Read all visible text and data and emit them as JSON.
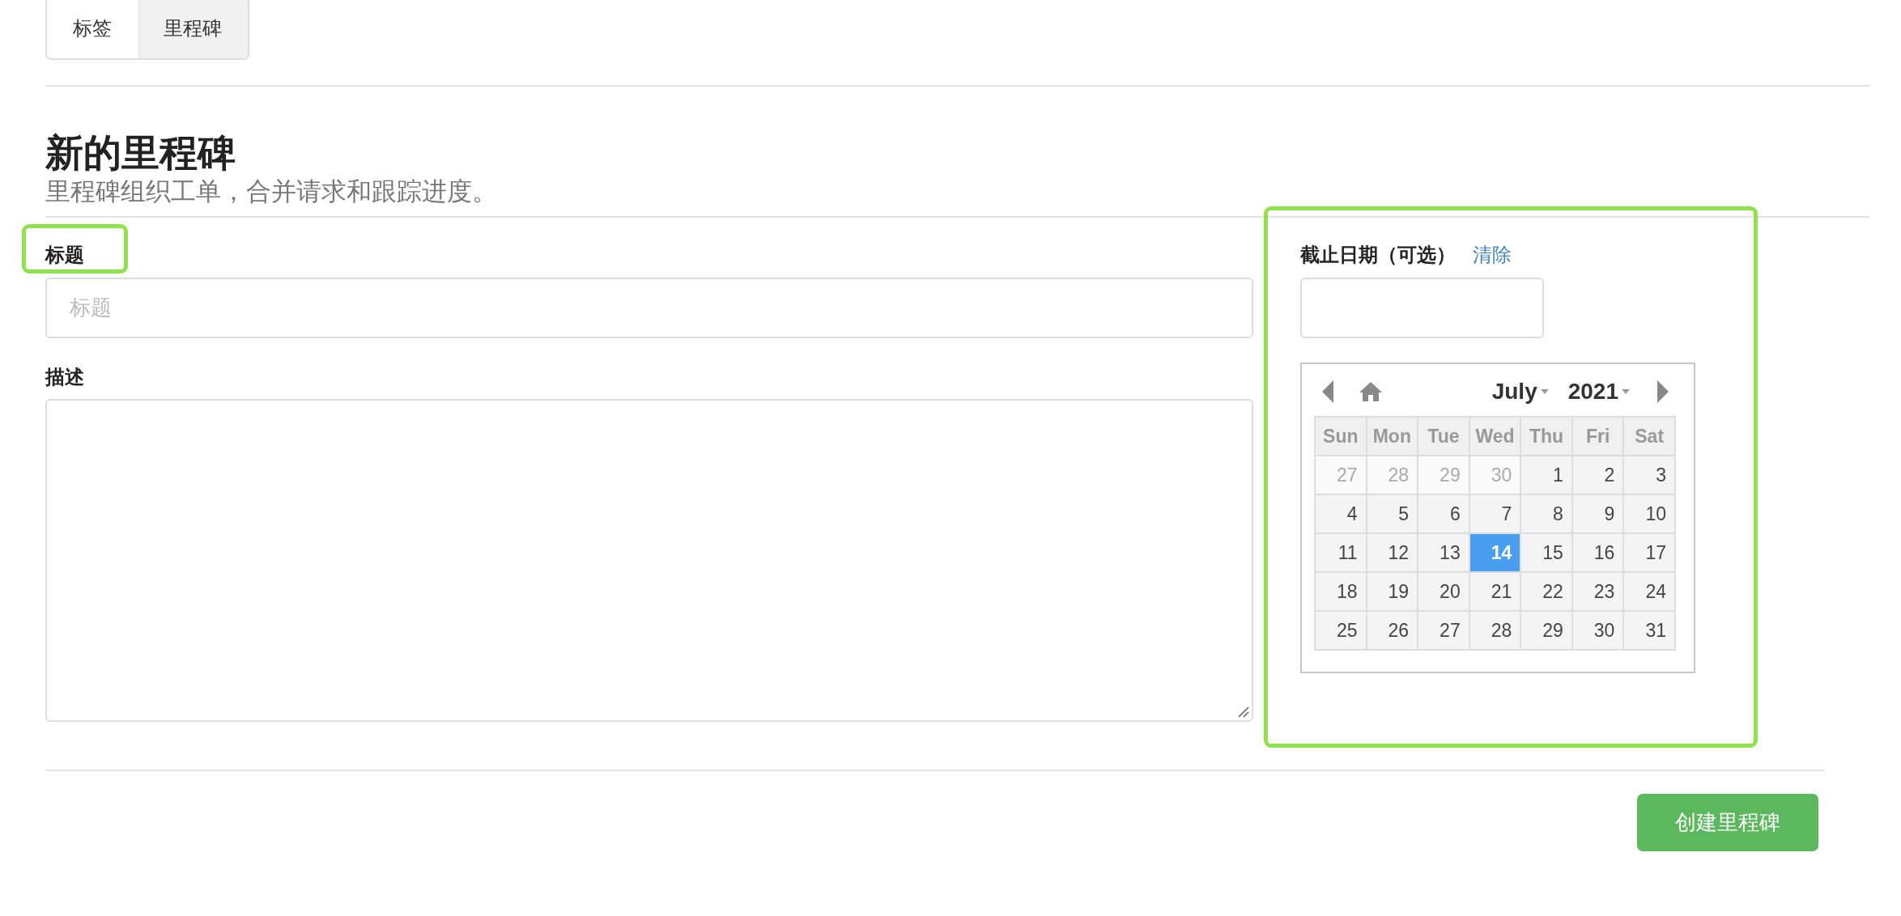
{
  "tabs": [
    {
      "label": "标签",
      "selected": false
    },
    {
      "label": "里程碑",
      "selected": true
    }
  ],
  "heading": {
    "title": "新的里程碑",
    "subtitle": "里程碑组织工单，合并请求和跟踪进度。"
  },
  "form": {
    "title": {
      "label": "标题",
      "placeholder": "标题"
    },
    "description": {
      "label": "描述"
    },
    "due_date": {
      "label": "截止日期（可选）",
      "clear_link": "清除"
    }
  },
  "calendar": {
    "month": "July",
    "year": "2021",
    "weekdays": [
      "Sun",
      "Mon",
      "Tue",
      "Wed",
      "Thu",
      "Fri",
      "Sat"
    ],
    "weeks": [
      [
        {
          "day": "27",
          "other_month": true,
          "selected": false
        },
        {
          "day": "28",
          "other_month": true,
          "selected": false
        },
        {
          "day": "29",
          "other_month": true,
          "selected": false
        },
        {
          "day": "30",
          "other_month": true,
          "selected": false
        },
        {
          "day": "1",
          "other_month": false,
          "selected": false
        },
        {
          "day": "2",
          "other_month": false,
          "selected": false
        },
        {
          "day": "3",
          "other_month": false,
          "selected": false
        }
      ],
      [
        {
          "day": "4",
          "other_month": false,
          "selected": false
        },
        {
          "day": "5",
          "other_month": false,
          "selected": false
        },
        {
          "day": "6",
          "other_month": false,
          "selected": false
        },
        {
          "day": "7",
          "other_month": false,
          "selected": false
        },
        {
          "day": "8",
          "other_month": false,
          "selected": false
        },
        {
          "day": "9",
          "other_month": false,
          "selected": false
        },
        {
          "day": "10",
          "other_month": false,
          "selected": false
        }
      ],
      [
        {
          "day": "11",
          "other_month": false,
          "selected": false
        },
        {
          "day": "12",
          "other_month": false,
          "selected": false
        },
        {
          "day": "13",
          "other_month": false,
          "selected": false
        },
        {
          "day": "14",
          "other_month": false,
          "selected": true
        },
        {
          "day": "15",
          "other_month": false,
          "selected": false
        },
        {
          "day": "16",
          "other_month": false,
          "selected": false
        },
        {
          "day": "17",
          "other_month": false,
          "selected": false
        }
      ],
      [
        {
          "day": "18",
          "other_month": false,
          "selected": false
        },
        {
          "day": "19",
          "other_month": false,
          "selected": false
        },
        {
          "day": "20",
          "other_month": false,
          "selected": false
        },
        {
          "day": "21",
          "other_month": false,
          "selected": false
        },
        {
          "day": "22",
          "other_month": false,
          "selected": false
        },
        {
          "day": "23",
          "other_month": false,
          "selected": false
        },
        {
          "day": "24",
          "other_month": false,
          "selected": false
        }
      ],
      [
        {
          "day": "25",
          "other_month": false,
          "selected": false
        },
        {
          "day": "26",
          "other_month": false,
          "selected": false
        },
        {
          "day": "27",
          "other_month": false,
          "selected": false
        },
        {
          "day": "28",
          "other_month": false,
          "selected": false
        },
        {
          "day": "29",
          "other_month": false,
          "selected": false
        },
        {
          "day": "30",
          "other_month": false,
          "selected": false
        },
        {
          "day": "31",
          "other_month": false,
          "selected": false
        }
      ]
    ]
  },
  "submit_button": "创建里程碑"
}
